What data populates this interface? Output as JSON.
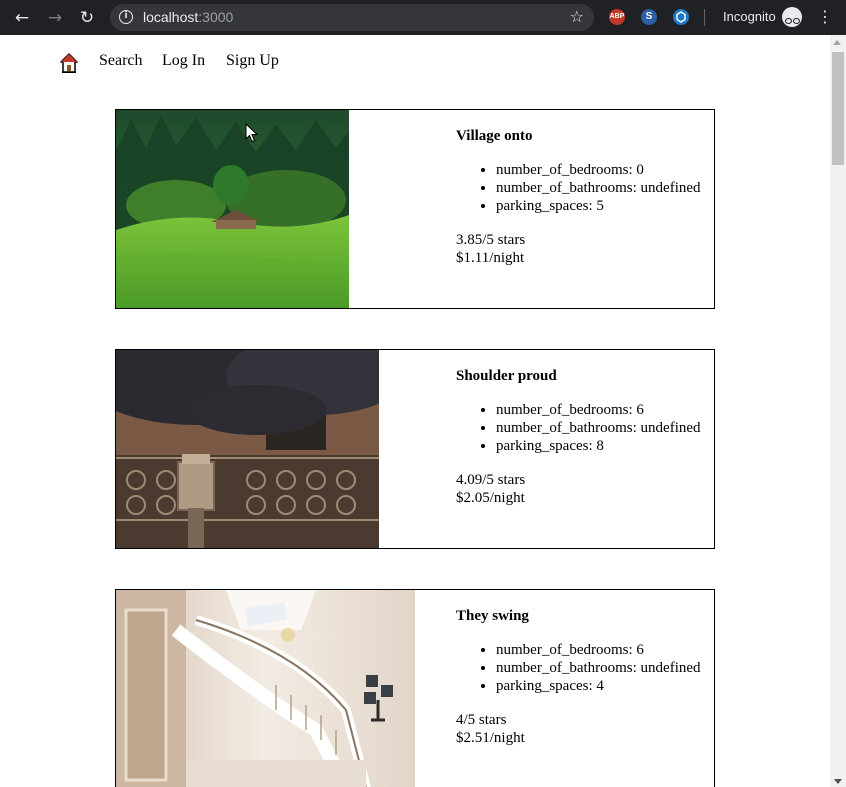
{
  "browser": {
    "url_host": "localhost",
    "url_port": ":3000",
    "incognito_label": "Incognito",
    "extensions": [
      "ABP",
      "S",
      ""
    ]
  },
  "nav": {
    "search": "Search",
    "login": "Log In",
    "signup": "Sign Up"
  },
  "listings": [
    {
      "title": "Village onto",
      "details": [
        "number_of_bedrooms: 0",
        "number_of_bathrooms: undefined",
        "parking_spaces: 5"
      ],
      "rating": "3.85/5 stars",
      "price": "$1.11/night"
    },
    {
      "title": "Shoulder proud",
      "details": [
        "number_of_bedrooms: 6",
        "number_of_bathrooms: undefined",
        "parking_spaces: 8"
      ],
      "rating": "4.09/5 stars",
      "price": "$2.05/night"
    },
    {
      "title": "They swing",
      "details": [
        "number_of_bedrooms: 6",
        "number_of_bathrooms: undefined",
        "parking_spaces: 4"
      ],
      "rating": "4/5 stars",
      "price": "$2.51/night"
    }
  ],
  "colors": {
    "chrome_bg": "#202124",
    "omnibox_bg": "#35363a",
    "page_bg": "#ffffff"
  }
}
